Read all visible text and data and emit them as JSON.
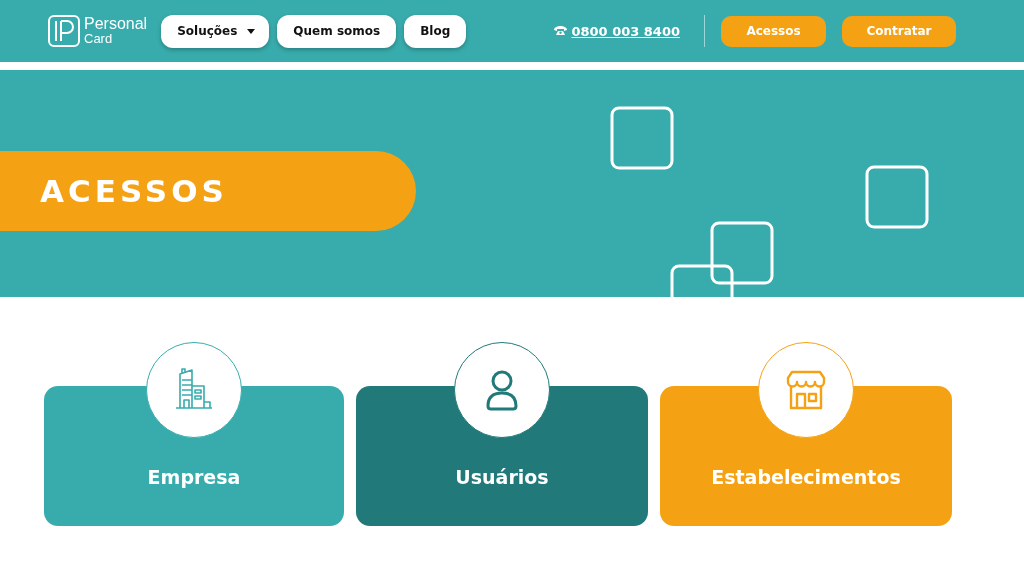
{
  "header": {
    "logo": {
      "line1": "Personal",
      "line2": "Card"
    },
    "nav": [
      {
        "label": "Soluções",
        "dropdown": true
      },
      {
        "label": "Quem somos",
        "dropdown": false
      },
      {
        "label": "Blog",
        "dropdown": false
      }
    ],
    "phone": "0800 003 8400",
    "actions": [
      "Acessos",
      "Contratar"
    ]
  },
  "hero": {
    "title": "ACESSOS"
  },
  "cards": [
    {
      "label": "Empresa",
      "kind": "building",
      "color": "#38acad"
    },
    {
      "label": "Usuários",
      "kind": "person",
      "color": "#217a79"
    },
    {
      "label": "Estabelecimentos",
      "kind": "store",
      "color": "#f4a214"
    }
  ]
}
